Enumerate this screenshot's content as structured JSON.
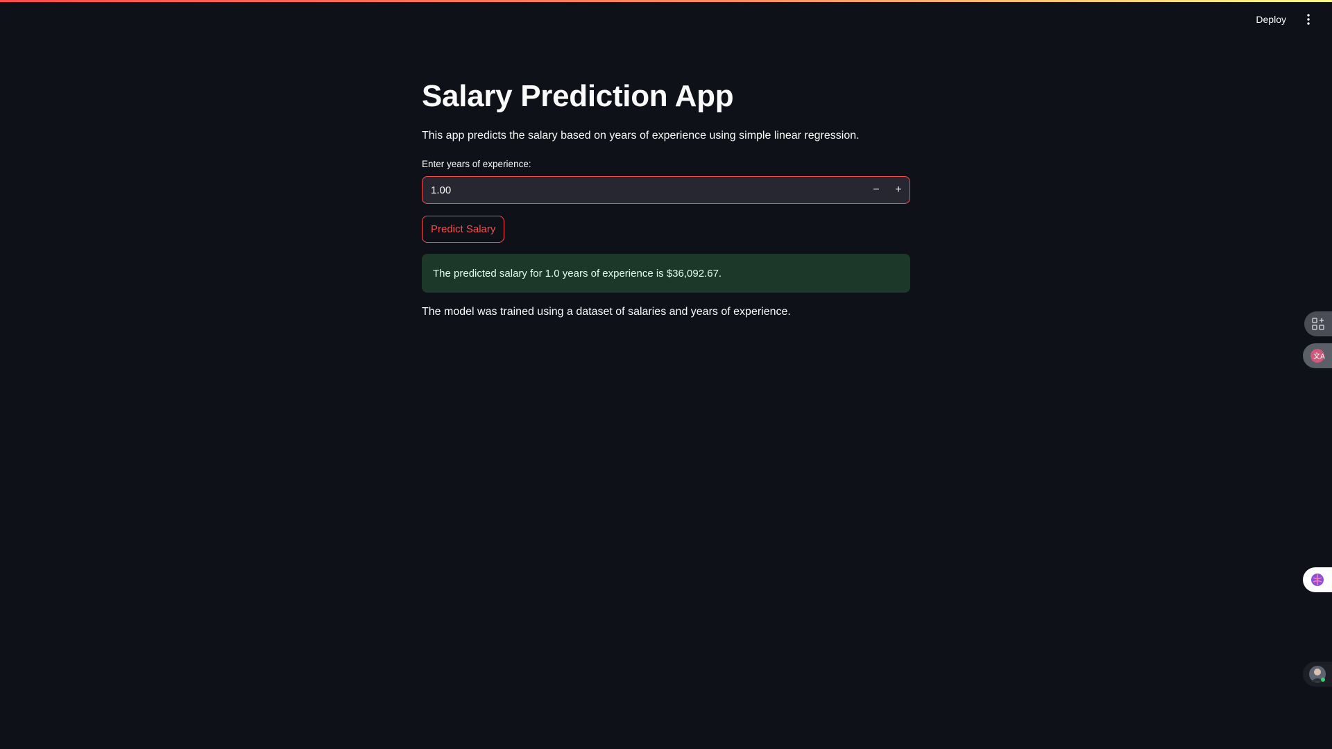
{
  "header": {
    "deploy_label": "Deploy",
    "menu_icon": "vertical-ellipsis-icon"
  },
  "main": {
    "title": "Salary Prediction App",
    "description": "This app predicts the salary based on years of experience using simple linear regression.",
    "input": {
      "label": "Enter years of experience:",
      "value": "1.00",
      "decrement_label": "−",
      "increment_label": "+"
    },
    "predict_button_label": "Predict Salary",
    "result_text": "The predicted salary for 1.0 years of experience is $36,092.67.",
    "footer_text": "The model was trained using a dataset of salaries and years of experience."
  },
  "side_widgets": [
    "apps-grid-icon",
    "translate-icon",
    "brain-icon",
    "avatar-icon"
  ],
  "colors": {
    "background": "#0e1117",
    "accent": "#ff4b4b",
    "success_bg": "#1c3829",
    "input_bg": "#262730"
  }
}
